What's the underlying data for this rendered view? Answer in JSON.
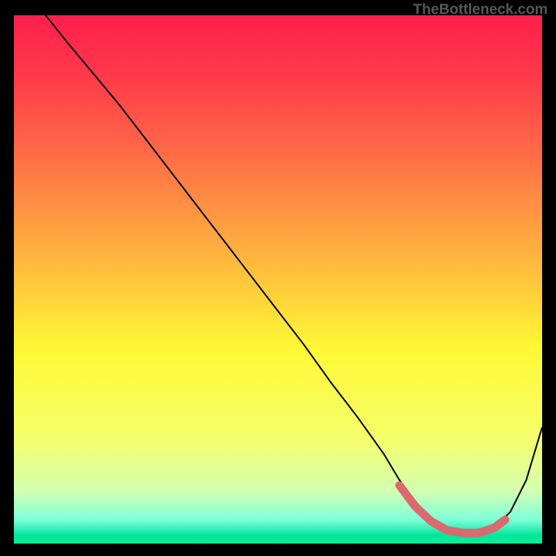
{
  "watermark": "TheBottleneck.com",
  "chart_data": {
    "type": "line",
    "title": "",
    "xlabel": "",
    "ylabel": "",
    "xlim": [
      0,
      100
    ],
    "ylim": [
      0,
      100
    ],
    "grid": false,
    "background_gradient": {
      "stops": [
        {
          "pos": 0.0,
          "color": "#ff1f4b"
        },
        {
          "pos": 0.12,
          "color": "#ff3b4a"
        },
        {
          "pos": 0.25,
          "color": "#ff6747"
        },
        {
          "pos": 0.45,
          "color": "#ffb23e"
        },
        {
          "pos": 0.63,
          "color": "#fff835"
        },
        {
          "pos": 0.8,
          "color": "#f5ff6a"
        },
        {
          "pos": 0.9,
          "color": "#d4ffb0"
        },
        {
          "pos": 0.955,
          "color": "#7effda"
        },
        {
          "pos": 0.985,
          "color": "#00e59a"
        },
        {
          "pos": 1.0,
          "color": "#00f29a"
        }
      ]
    },
    "series": [
      {
        "name": "bottleneck-curve",
        "color": "#000000",
        "x": [
          6,
          10,
          15,
          20,
          25,
          30,
          35,
          40,
          45,
          50,
          55,
          60,
          65,
          70,
          73,
          76,
          79,
          82,
          85,
          88,
          91,
          94,
          97,
          100
        ],
        "y": [
          100,
          95,
          89,
          83,
          76.5,
          70,
          63.5,
          57,
          50.5,
          44,
          37.5,
          30.5,
          24,
          17,
          12,
          8,
          4.5,
          2.5,
          2,
          2,
          3,
          6,
          12,
          22
        ]
      }
    ],
    "highlight": {
      "name": "optimal-band",
      "color": "#d96a6f",
      "thickness": 12,
      "x": [
        73,
        76,
        79,
        82,
        85,
        88,
        91,
        93
      ],
      "y": [
        11,
        7,
        4.2,
        2.5,
        2,
        2,
        3,
        4.5
      ]
    }
  }
}
